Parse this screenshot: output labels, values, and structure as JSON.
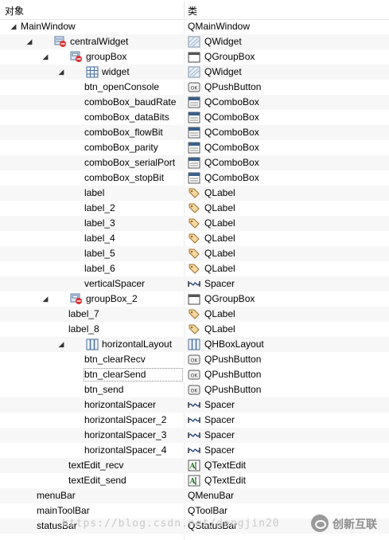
{
  "header": {
    "col_object": "对象",
    "col_class": "类"
  },
  "rows": [
    {
      "name": "MainWindow",
      "cls": "QMainWindow",
      "arrow": "◢",
      "icon": "none",
      "cicon": "none"
    },
    {
      "name": "centralWidget",
      "cls": "QWidget",
      "arrow": "◢",
      "icon": "widget-forbidden",
      "cicon": "widget"
    },
    {
      "name": "groupBox",
      "cls": "QGroupBox",
      "arrow": "◢",
      "icon": "groupbox-forbidden",
      "cicon": "groupbox"
    },
    {
      "name": "widget",
      "cls": "QWidget",
      "arrow": "◢",
      "icon": "grid-layout",
      "cicon": "widget"
    },
    {
      "name": "btn_openConsole",
      "cls": "QPushButton",
      "arrow": "",
      "icon": "none",
      "cicon": "pushbutton"
    },
    {
      "name": "comboBox_baudRate",
      "cls": "QComboBox",
      "arrow": "",
      "icon": "none",
      "cicon": "combobox"
    },
    {
      "name": "comboBox_dataBits",
      "cls": "QComboBox",
      "arrow": "",
      "icon": "none",
      "cicon": "combobox"
    },
    {
      "name": "comboBox_flowBit",
      "cls": "QComboBox",
      "arrow": "",
      "icon": "none",
      "cicon": "combobox"
    },
    {
      "name": "comboBox_parity",
      "cls": "QComboBox",
      "arrow": "",
      "icon": "none",
      "cicon": "combobox"
    },
    {
      "name": "comboBox_serialPort",
      "cls": "QComboBox",
      "arrow": "",
      "icon": "none",
      "cicon": "combobox"
    },
    {
      "name": "comboBox_stopBit",
      "cls": "QComboBox",
      "arrow": "",
      "icon": "none",
      "cicon": "combobox"
    },
    {
      "name": "label",
      "cls": "QLabel",
      "arrow": "",
      "icon": "none",
      "cicon": "label"
    },
    {
      "name": "label_2",
      "cls": "QLabel",
      "arrow": "",
      "icon": "none",
      "cicon": "label"
    },
    {
      "name": "label_3",
      "cls": "QLabel",
      "arrow": "",
      "icon": "none",
      "cicon": "label"
    },
    {
      "name": "label_4",
      "cls": "QLabel",
      "arrow": "",
      "icon": "none",
      "cicon": "label"
    },
    {
      "name": "label_5",
      "cls": "QLabel",
      "arrow": "",
      "icon": "none",
      "cicon": "label"
    },
    {
      "name": "label_6",
      "cls": "QLabel",
      "arrow": "",
      "icon": "none",
      "cicon": "label"
    },
    {
      "name": "verticalSpacer",
      "cls": "Spacer",
      "arrow": "",
      "icon": "none",
      "cicon": "spacer"
    },
    {
      "name": "groupBox_2",
      "cls": "QGroupBox",
      "arrow": "◢",
      "icon": "groupbox-forbidden",
      "cicon": "groupbox"
    },
    {
      "name": "label_7",
      "cls": "QLabel",
      "arrow": "",
      "icon": "none",
      "cicon": "label"
    },
    {
      "name": "label_8",
      "cls": "QLabel",
      "arrow": "",
      "icon": "none",
      "cicon": "label"
    },
    {
      "name": "horizontalLayout",
      "cls": "QHBoxLayout",
      "arrow": "◢",
      "icon": "hbox",
      "cicon": "hbox"
    },
    {
      "name": "btn_clearRecv",
      "cls": "QPushButton",
      "arrow": "",
      "icon": "none",
      "cicon": "pushbutton"
    },
    {
      "name": "btn_clearSend",
      "cls": "QPushButton",
      "arrow": "",
      "icon": "none",
      "cicon": "pushbutton",
      "selected": true
    },
    {
      "name": "btn_send",
      "cls": "QPushButton",
      "arrow": "",
      "icon": "none",
      "cicon": "pushbutton"
    },
    {
      "name": "horizontalSpacer",
      "cls": "Spacer",
      "arrow": "",
      "icon": "none",
      "cicon": "spacer"
    },
    {
      "name": "horizontalSpacer_2",
      "cls": "Spacer",
      "arrow": "",
      "icon": "none",
      "cicon": "spacer"
    },
    {
      "name": "horizontalSpacer_3",
      "cls": "Spacer",
      "arrow": "",
      "icon": "none",
      "cicon": "spacer"
    },
    {
      "name": "horizontalSpacer_4",
      "cls": "Spacer",
      "arrow": "",
      "icon": "none",
      "cicon": "spacer"
    },
    {
      "name": "textEdit_recv",
      "cls": "QTextEdit",
      "arrow": "",
      "icon": "none",
      "cicon": "textedit"
    },
    {
      "name": "textEdit_send",
      "cls": "QTextEdit",
      "arrow": "",
      "icon": "none",
      "cicon": "textedit"
    },
    {
      "name": "menuBar",
      "cls": "QMenuBar",
      "arrow": "",
      "icon": "none",
      "cicon": "none"
    },
    {
      "name": "mainToolBar",
      "cls": "QToolBar",
      "arrow": "",
      "icon": "none",
      "cicon": "none"
    },
    {
      "name": "statusBar",
      "cls": "QStatusBar",
      "arrow": "",
      "icon": "none",
      "cicon": "none"
    }
  ],
  "watermark": "https://blog.csdn.net/dengjin20",
  "logo_text": "创新互联"
}
